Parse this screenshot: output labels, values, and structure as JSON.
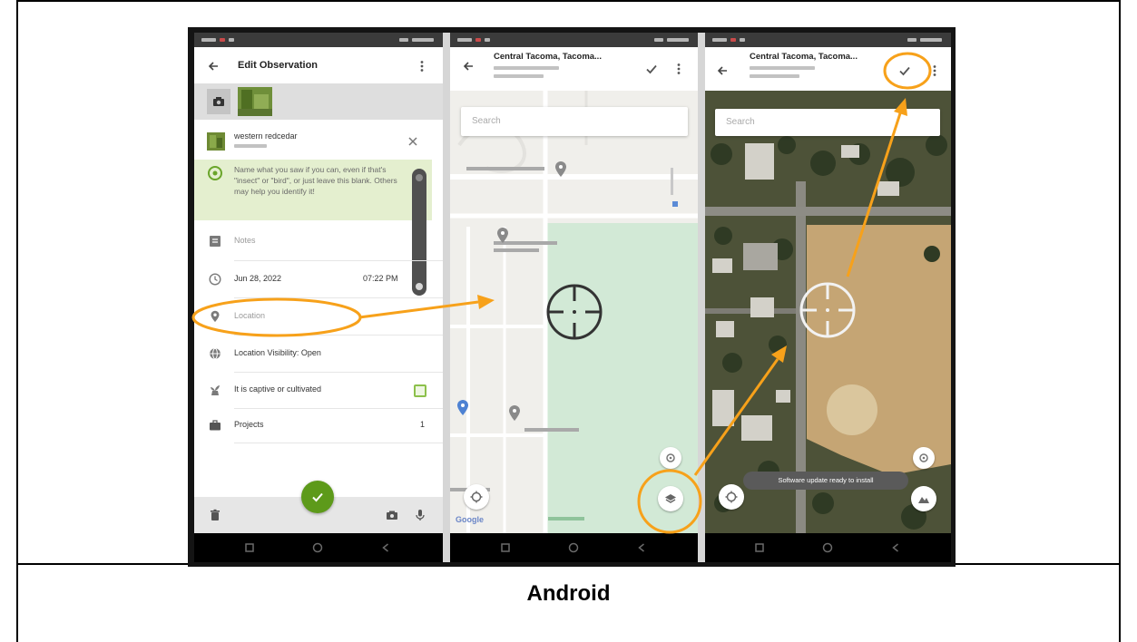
{
  "caption": "Android",
  "colors": {
    "annotation": "#f7a11a",
    "inat_green": "#5d9a1a",
    "hint_background": "#e4efcf",
    "park_green": "#d2e9d6",
    "field_tan": "#c5a574"
  },
  "edit_observation": {
    "title": "Edit Observation",
    "species_name": "western redcedar",
    "hint_lines": [
      "Name what you saw if you can, even if that's",
      "\"insect\" or \"bird\", or just leave this blank. Others",
      "may help you identify it!"
    ],
    "notes_placeholder": "Notes",
    "date": "Jun 28, 2022",
    "time": "07:22 PM",
    "location_placeholder": "Location",
    "location_visibility": "Location Visibility: Open",
    "captive_label": "It is captive or cultivated",
    "projects_label": "Projects",
    "projects_count": "1"
  },
  "location_map": {
    "title": "Central Tacoma, Tacoma...",
    "search_placeholder": "Search",
    "attribution": "Google"
  },
  "location_satellite": {
    "title": "Central Tacoma, Tacoma...",
    "search_placeholder": "Search",
    "toast": "Software update ready to install"
  },
  "icons": {
    "back": "back-arrow-icon",
    "menu": "more-vert-icon",
    "confirm": "check-icon",
    "layers": "layers-icon",
    "my_location": "my-location-icon",
    "nav": [
      "recents-icon",
      "home-icon",
      "back-triangle-icon"
    ]
  }
}
